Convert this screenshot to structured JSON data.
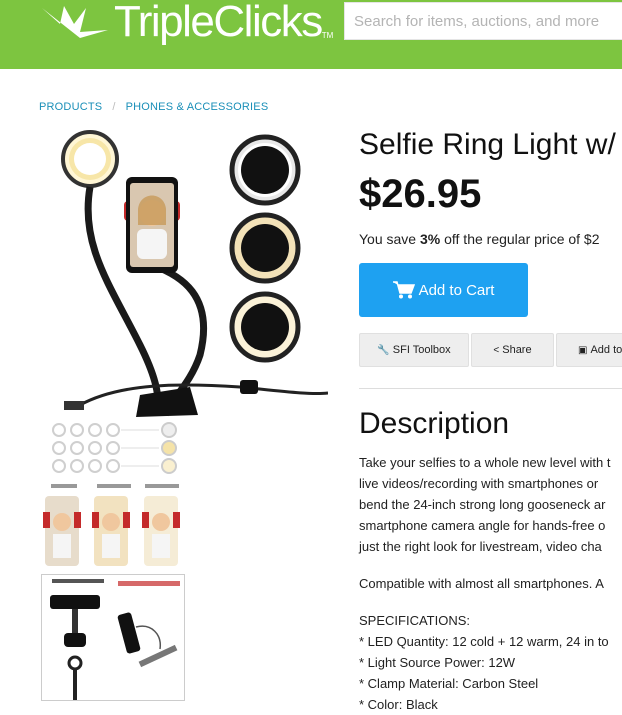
{
  "header": {
    "logo_text": "TripleClicks",
    "logo_tm": "TM",
    "search_placeholder": "Search for items, auctions, and more"
  },
  "breadcrumb": {
    "items": [
      "PRODUCTS",
      "PHONES & ACCESSORIES"
    ],
    "separator": "/"
  },
  "product": {
    "title": "Selfie Ring Light w/",
    "price": "$26.95",
    "save_prefix": "You save ",
    "save_percent": "3%",
    "save_suffix": " off the regular price of $2",
    "add_to_cart": "Add to Cart",
    "buttons": {
      "toolbox": "SFI Toolbox",
      "share": "Share",
      "add": "Add to"
    }
  },
  "description": {
    "heading": "Description",
    "lines": [
      "Take your selfies to a whole new level with t",
      "live videos/recording with smartphones or",
      "bend the 24-inch strong long gooseneck ar",
      "smartphone camera angle for hands-free o",
      "just the right look for livestream, video cha"
    ],
    "compat": "Compatible with almost all smartphones. A",
    "spec_title": "SPECIFICATIONS:",
    "specs": [
      "* LED Quantity: 12 cold + 12 warm, 24 in to",
      "* Light Source Power: 12W",
      "* Clamp Material: Carbon Steel",
      "* Color: Black"
    ]
  },
  "colors": {
    "header_green": "#7dc540",
    "link_blue": "#1a8fb8",
    "cart_blue": "#1ea1f1"
  }
}
